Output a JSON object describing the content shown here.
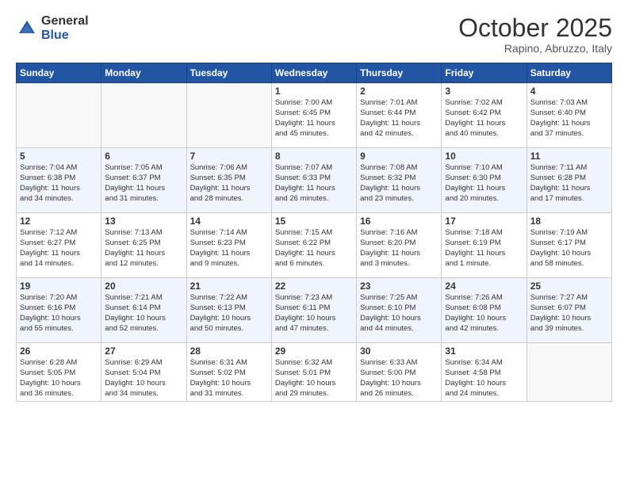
{
  "header": {
    "logo_general": "General",
    "logo_blue": "Blue",
    "month_title": "October 2025",
    "location": "Rapino, Abruzzo, Italy"
  },
  "days_of_week": [
    "Sunday",
    "Monday",
    "Tuesday",
    "Wednesday",
    "Thursday",
    "Friday",
    "Saturday"
  ],
  "weeks": [
    {
      "alt": false,
      "days": [
        {
          "num": "",
          "info": ""
        },
        {
          "num": "",
          "info": ""
        },
        {
          "num": "",
          "info": ""
        },
        {
          "num": "1",
          "info": "Sunrise: 7:00 AM\nSunset: 6:45 PM\nDaylight: 11 hours\nand 45 minutes."
        },
        {
          "num": "2",
          "info": "Sunrise: 7:01 AM\nSunset: 6:44 PM\nDaylight: 11 hours\nand 42 minutes."
        },
        {
          "num": "3",
          "info": "Sunrise: 7:02 AM\nSunset: 6:42 PM\nDaylight: 11 hours\nand 40 minutes."
        },
        {
          "num": "4",
          "info": "Sunrise: 7:03 AM\nSunset: 6:40 PM\nDaylight: 11 hours\nand 37 minutes."
        }
      ]
    },
    {
      "alt": true,
      "days": [
        {
          "num": "5",
          "info": "Sunrise: 7:04 AM\nSunset: 6:38 PM\nDaylight: 11 hours\nand 34 minutes."
        },
        {
          "num": "6",
          "info": "Sunrise: 7:05 AM\nSunset: 6:37 PM\nDaylight: 11 hours\nand 31 minutes."
        },
        {
          "num": "7",
          "info": "Sunrise: 7:06 AM\nSunset: 6:35 PM\nDaylight: 11 hours\nand 28 minutes."
        },
        {
          "num": "8",
          "info": "Sunrise: 7:07 AM\nSunset: 6:33 PM\nDaylight: 11 hours\nand 26 minutes."
        },
        {
          "num": "9",
          "info": "Sunrise: 7:08 AM\nSunset: 6:32 PM\nDaylight: 11 hours\nand 23 minutes."
        },
        {
          "num": "10",
          "info": "Sunrise: 7:10 AM\nSunset: 6:30 PM\nDaylight: 11 hours\nand 20 minutes."
        },
        {
          "num": "11",
          "info": "Sunrise: 7:11 AM\nSunset: 6:28 PM\nDaylight: 11 hours\nand 17 minutes."
        }
      ]
    },
    {
      "alt": false,
      "days": [
        {
          "num": "12",
          "info": "Sunrise: 7:12 AM\nSunset: 6:27 PM\nDaylight: 11 hours\nand 14 minutes."
        },
        {
          "num": "13",
          "info": "Sunrise: 7:13 AM\nSunset: 6:25 PM\nDaylight: 11 hours\nand 12 minutes."
        },
        {
          "num": "14",
          "info": "Sunrise: 7:14 AM\nSunset: 6:23 PM\nDaylight: 11 hours\nand 9 minutes."
        },
        {
          "num": "15",
          "info": "Sunrise: 7:15 AM\nSunset: 6:22 PM\nDaylight: 11 hours\nand 6 minutes."
        },
        {
          "num": "16",
          "info": "Sunrise: 7:16 AM\nSunset: 6:20 PM\nDaylight: 11 hours\nand 3 minutes."
        },
        {
          "num": "17",
          "info": "Sunrise: 7:18 AM\nSunset: 6:19 PM\nDaylight: 11 hours\nand 1 minute."
        },
        {
          "num": "18",
          "info": "Sunrise: 7:19 AM\nSunset: 6:17 PM\nDaylight: 10 hours\nand 58 minutes."
        }
      ]
    },
    {
      "alt": true,
      "days": [
        {
          "num": "19",
          "info": "Sunrise: 7:20 AM\nSunset: 6:16 PM\nDaylight: 10 hours\nand 55 minutes."
        },
        {
          "num": "20",
          "info": "Sunrise: 7:21 AM\nSunset: 6:14 PM\nDaylight: 10 hours\nand 52 minutes."
        },
        {
          "num": "21",
          "info": "Sunrise: 7:22 AM\nSunset: 6:13 PM\nDaylight: 10 hours\nand 50 minutes."
        },
        {
          "num": "22",
          "info": "Sunrise: 7:23 AM\nSunset: 6:11 PM\nDaylight: 10 hours\nand 47 minutes."
        },
        {
          "num": "23",
          "info": "Sunrise: 7:25 AM\nSunset: 6:10 PM\nDaylight: 10 hours\nand 44 minutes."
        },
        {
          "num": "24",
          "info": "Sunrise: 7:26 AM\nSunset: 6:08 PM\nDaylight: 10 hours\nand 42 minutes."
        },
        {
          "num": "25",
          "info": "Sunrise: 7:27 AM\nSunset: 6:07 PM\nDaylight: 10 hours\nand 39 minutes."
        }
      ]
    },
    {
      "alt": false,
      "days": [
        {
          "num": "26",
          "info": "Sunrise: 6:28 AM\nSunset: 5:05 PM\nDaylight: 10 hours\nand 36 minutes."
        },
        {
          "num": "27",
          "info": "Sunrise: 6:29 AM\nSunset: 5:04 PM\nDaylight: 10 hours\nand 34 minutes."
        },
        {
          "num": "28",
          "info": "Sunrise: 6:31 AM\nSunset: 5:02 PM\nDaylight: 10 hours\nand 31 minutes."
        },
        {
          "num": "29",
          "info": "Sunrise: 6:32 AM\nSunset: 5:01 PM\nDaylight: 10 hours\nand 29 minutes."
        },
        {
          "num": "30",
          "info": "Sunrise: 6:33 AM\nSunset: 5:00 PM\nDaylight: 10 hours\nand 26 minutes."
        },
        {
          "num": "31",
          "info": "Sunrise: 6:34 AM\nSunset: 4:58 PM\nDaylight: 10 hours\nand 24 minutes."
        },
        {
          "num": "",
          "info": ""
        }
      ]
    }
  ]
}
